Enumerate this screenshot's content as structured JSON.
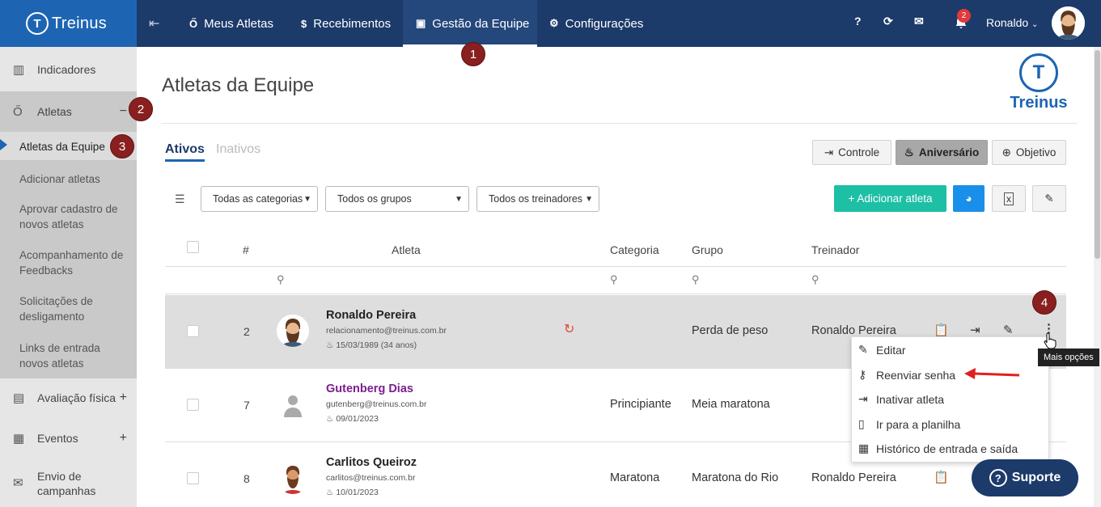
{
  "topbar": {
    "brand": "Treinus",
    "nav": [
      {
        "label": "Meus Atletas"
      },
      {
        "label": "Recebimentos"
      },
      {
        "label": "Gestão da Equipe"
      },
      {
        "label": "Configurações"
      }
    ],
    "icons": {
      "help": "?",
      "sync": "⟳",
      "mail": "✉",
      "bell": "bell-icon"
    },
    "notifications": "2",
    "user": "Ronaldo",
    "nav_bg": "#1c3a6a",
    "brand_bg": "#1d65b3"
  },
  "markers": [
    "1",
    "2",
    "3",
    "4"
  ],
  "sidebar": {
    "items": [
      {
        "label": "Indicadores"
      },
      {
        "label": "Atletas",
        "toggle": "−"
      },
      {
        "label": "Avaliação física",
        "toggle": "+"
      },
      {
        "label": "Eventos",
        "toggle": "+"
      },
      {
        "label": "Envio de campanhas"
      }
    ],
    "sub": [
      {
        "label": "Atletas da Equipe"
      },
      {
        "label": "Adicionar atletas"
      },
      {
        "label": "Aprovar cadastro de novos atletas"
      },
      {
        "label": "Acompanhamento de Feedbacks"
      },
      {
        "label": "Solicitações de desligamento"
      },
      {
        "label": "Links de entrada novos atletas"
      }
    ]
  },
  "page": {
    "title": "Atletas da Equipe",
    "brand": "Treinus",
    "tabs": {
      "active": "Ativos",
      "inactive": "Inativos"
    },
    "buttons": {
      "controle": "Controle",
      "aniversario": "Aniversário",
      "objetivo": "Objetivo",
      "add": "+ Adicionar atleta"
    },
    "filters": [
      "Todas as categorias",
      "Todos os grupos",
      "Todos os treinadores"
    ]
  },
  "table": {
    "headers": {
      "num": "#",
      "athlete": "Atleta",
      "category": "Categoria",
      "group": "Grupo",
      "coach": "Treinador"
    },
    "rows": [
      {
        "num": "2",
        "name": "Ronaldo Pereira",
        "email": "relacionamento@treinus.com.br",
        "birthday": "15/03/1989 (34 anos)",
        "category": "",
        "group": "Perda de peso",
        "coach": "Ronaldo Pereira"
      },
      {
        "num": "7",
        "name": "Gutenberg Dias",
        "email": "gutenberg@treinus.com.br",
        "birthday": "09/01/2023",
        "category": "Principiante",
        "group": "Meia maratona",
        "coach": ""
      },
      {
        "num": "8",
        "name": "Carlitos Queiroz",
        "email": "carlitos@treinus.com.br",
        "birthday": "10/01/2023",
        "category": "Maratona",
        "group": "Maratona do Rio",
        "coach": "Ronaldo Pereira"
      }
    ]
  },
  "menu": {
    "items": [
      {
        "label": "Editar",
        "icon": "edit-icon"
      },
      {
        "label": "Reenviar senha",
        "icon": "key-icon"
      },
      {
        "label": "Inativar atleta",
        "icon": "logout-icon"
      },
      {
        "label": "Ir para a planilha",
        "icon": "clipboard-icon"
      },
      {
        "label": "Histórico de entrada e saída",
        "icon": "calendar-icon"
      }
    ]
  },
  "tooltip": "Mais opções",
  "support": "Suporte"
}
